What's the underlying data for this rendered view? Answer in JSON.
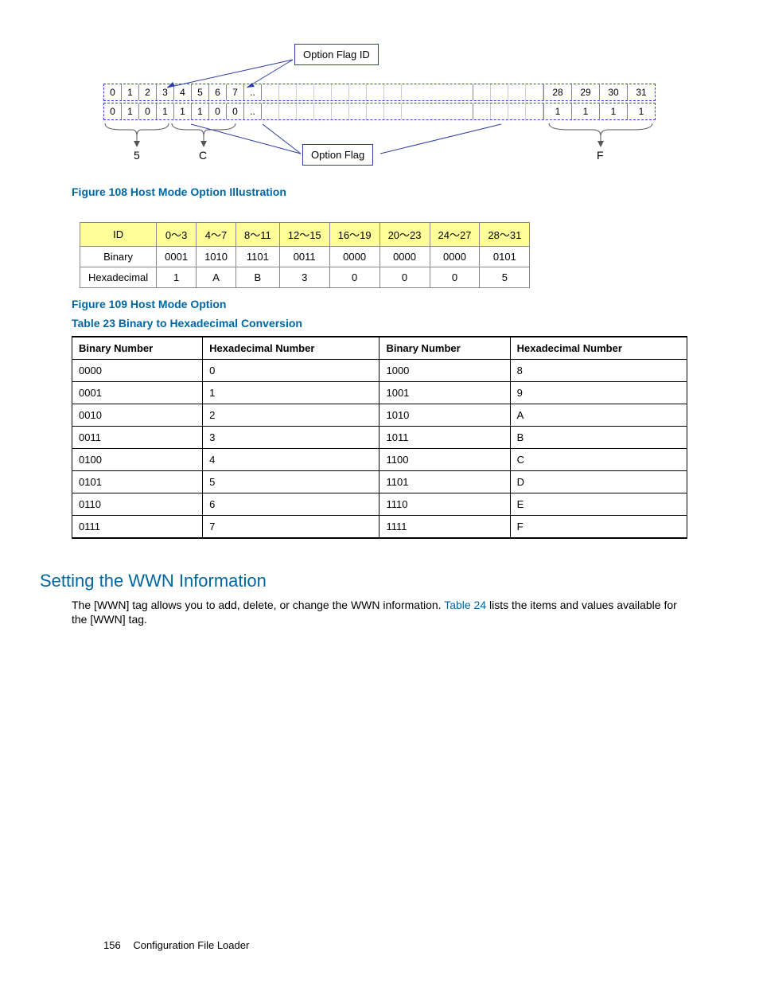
{
  "fig108": {
    "option_flag_id_label": "Option Flag ID",
    "option_flag_label": "Option Flag",
    "id_left": [
      "0",
      "1",
      "2",
      "3",
      "4",
      "5",
      "6",
      "7",
      ".."
    ],
    "id_right": [
      "28",
      "29",
      "30",
      "31"
    ],
    "bin_left": [
      "0",
      "1",
      "0",
      "1",
      "1",
      "1",
      "0",
      "0",
      ".."
    ],
    "bin_right": [
      "1",
      "1",
      "1",
      "1"
    ],
    "hex_5": "5",
    "hex_C": "C",
    "hex_F": "F",
    "caption": "Figure 108 Host Mode Option Illustration"
  },
  "fig109": {
    "headers": [
      "ID",
      "0～3",
      "4～7",
      "8～11",
      "12～15",
      "16～19",
      "20～23",
      "24～27",
      "28～31"
    ],
    "rows": [
      {
        "label": "Binary",
        "cells": [
          "0001",
          "1010",
          "1101",
          "0011",
          "0000",
          "0000",
          "0000",
          "0101"
        ]
      },
      {
        "label": "Hexadecimal",
        "cells": [
          "1",
          "A",
          "B",
          "3",
          "0",
          "0",
          "0",
          "5"
        ]
      }
    ],
    "caption": "Figure 109 Host Mode Option"
  },
  "tbl23": {
    "caption": "Table 23 Binary to Hexadecimal Conversion",
    "headers": [
      "Binary Number",
      "Hexadecimal Number",
      "Binary Number",
      "Hexadecimal Number"
    ],
    "rows": [
      [
        "0000",
        "0",
        "1000",
        "8"
      ],
      [
        "0001",
        "1",
        "1001",
        "9"
      ],
      [
        "0010",
        "2",
        "1010",
        "A"
      ],
      [
        "0011",
        "3",
        "1011",
        "B"
      ],
      [
        "0100",
        "4",
        "1100",
        "C"
      ],
      [
        "0101",
        "5",
        "1101",
        "D"
      ],
      [
        "0110",
        "6",
        "1110",
        "E"
      ],
      [
        "0111",
        "7",
        "1111",
        "F"
      ]
    ]
  },
  "section": {
    "heading": "Setting the WWN Information",
    "body_pre": "The [WWN] tag allows you to add, delete, or change the WWN information. ",
    "body_link": "Table 24",
    "body_post": " lists the items and values available for the [WWN] tag."
  },
  "footer": {
    "page": "156",
    "title": "Configuration File Loader"
  }
}
